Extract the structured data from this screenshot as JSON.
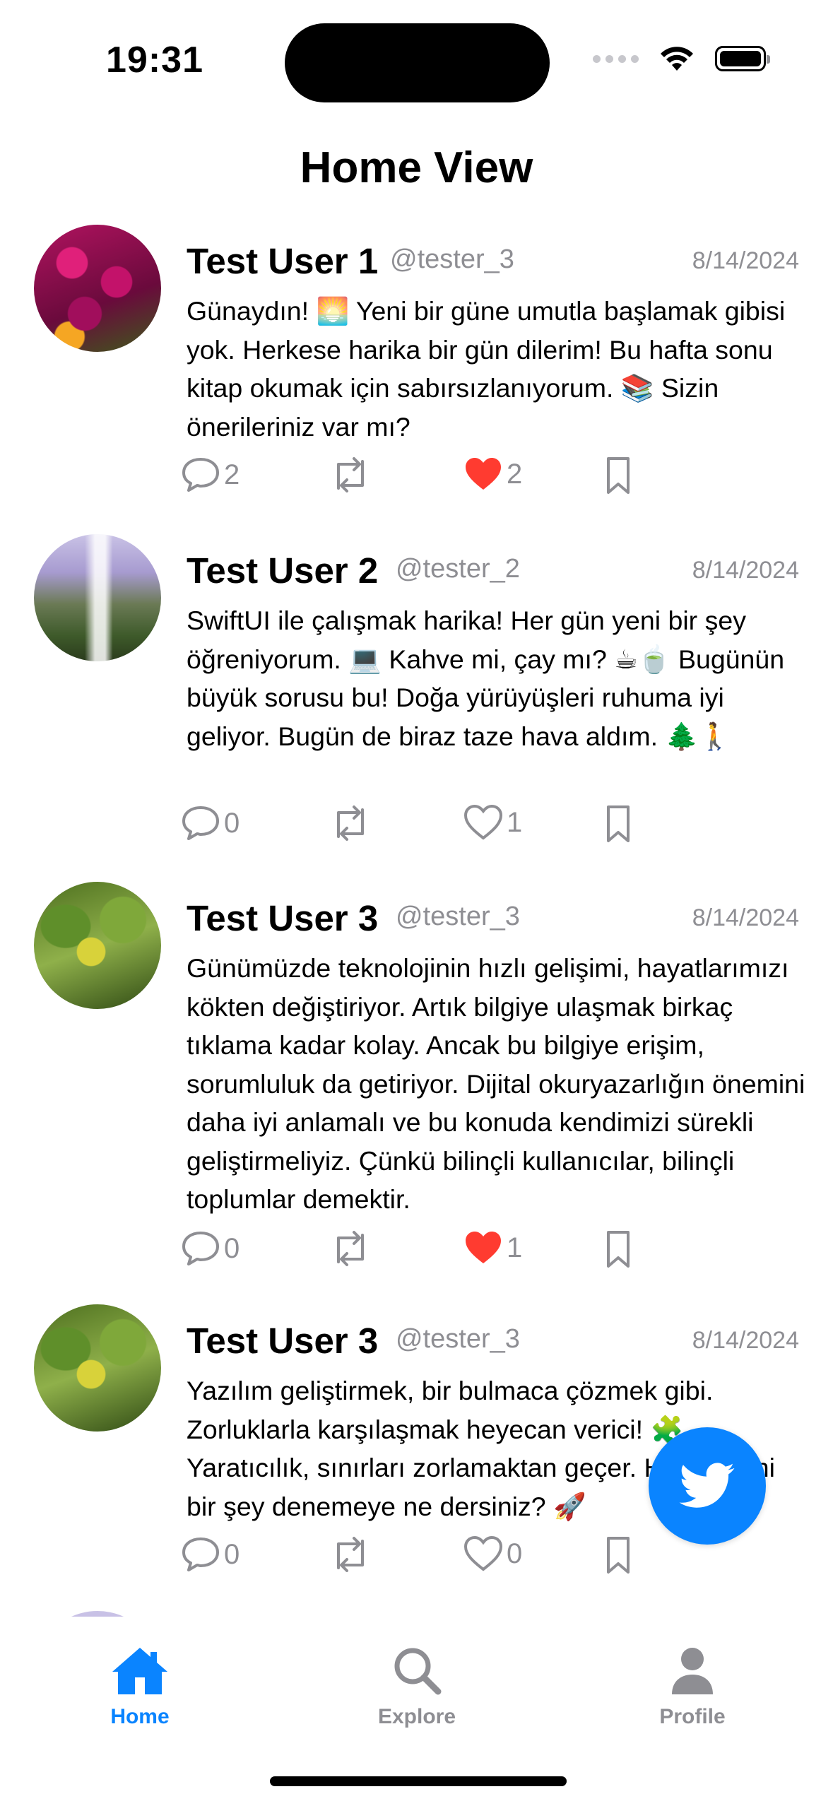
{
  "status_bar": {
    "time": "19:31"
  },
  "header": {
    "title": "Home View"
  },
  "posts": [
    {
      "name": "Test User 1",
      "handle": "@tester_3",
      "date": "8/14/2024",
      "text": "Günaydın! 🌅 Yeni bir güne umutla başlamak gibisi yok. Herkese harika bir gün dilerim! Bu hafta sonu kitap okumak için sabırsızlanıyorum. 📚 Sizin önerileriniz var mı?",
      "comments": "2",
      "likes": "2",
      "liked": true,
      "avatar_icon": "flowers-photo"
    },
    {
      "name": "Test User 2",
      "handle": "@tester_2",
      "date": "8/14/2024",
      "text": "SwiftUI ile çalışmak harika! Her gün yeni bir şey öğreniyorum. 💻 Kahve mi, çay mı? ☕🍵 Bugünün büyük sorusu bu! Doğa yürüyüşleri ruhuma iyi geliyor. Bugün de biraz taze hava aldım. 🌲🚶",
      "comments": "0",
      "likes": "1",
      "liked": false,
      "avatar_icon": "waterfall-photo"
    },
    {
      "name": "Test User 3",
      "handle": "@tester_3",
      "date": "8/14/2024",
      "text": "Günümüzde teknolojinin hızlı gelişimi, hayatlarımızı kökten değiştiriyor. Artık bilgiye ulaşmak birkaç tıklama kadar kolay. Ancak bu bilgiye erişim, sorumluluk da getiriyor. Dijital okuryazarlığın önemini daha iyi anlamalı ve bu konuda kendimizi sürekli geliştirmeliyiz. Çünkü bilinçli kullanıcılar, bilinçli toplumlar demektir.",
      "comments": "0",
      "likes": "1",
      "liked": true,
      "avatar_icon": "leaves-photo"
    },
    {
      "name": "Test User 3",
      "handle": "@tester_3",
      "date": "8/14/2024",
      "text": "Yazılım geliştirmek, bir bulmaca çözmek gibi. Zorluklarla karşılaşmak heyecan verici! 🧩 Yaratıcılık, sınırları zorlamaktan geçer. Haydi, yeni bir şey denemeye ne dersiniz? 🚀",
      "comments": "0",
      "likes": "0",
      "liked": false,
      "avatar_icon": "leaves-photo"
    }
  ],
  "fab": {
    "icon": "twitter-bird-icon"
  },
  "tabs": [
    {
      "label": "Home",
      "icon": "house-icon",
      "active": true
    },
    {
      "label": "Explore",
      "icon": "magnifier-icon",
      "active": false
    },
    {
      "label": "Profile",
      "icon": "person-icon",
      "active": false
    }
  ],
  "colors": {
    "accent": "#0a84ff",
    "like": "#ff3b30",
    "secondary": "#8e8e93"
  }
}
